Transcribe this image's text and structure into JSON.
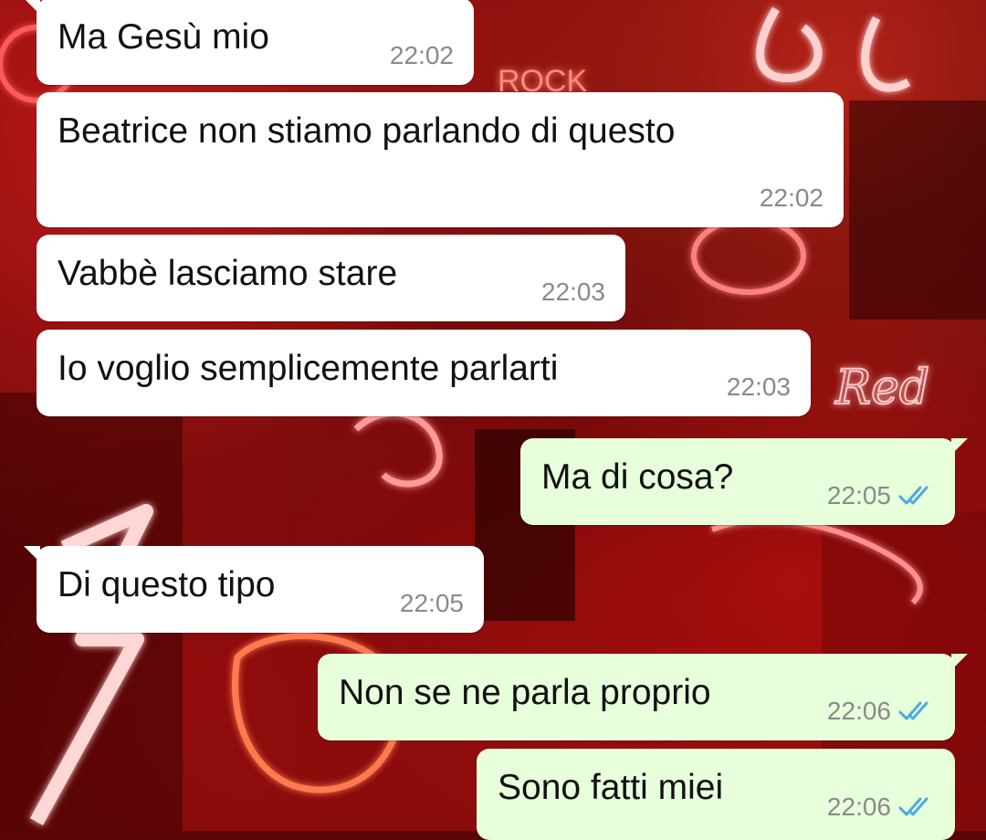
{
  "wallpaper": {
    "sign_rock": "ROCK",
    "sign_red": "Red"
  },
  "messages": [
    {
      "direction": "in",
      "text": "Ma Gesù mio",
      "time": "22:02"
    },
    {
      "direction": "in",
      "text": "Beatrice non stiamo parlando di questo",
      "time": "22:02"
    },
    {
      "direction": "in",
      "text": "Vabbè lasciamo stare",
      "time": "22:03"
    },
    {
      "direction": "in",
      "text": "Io voglio semplicemente parlarti",
      "time": "22:03"
    },
    {
      "direction": "out",
      "text": "Ma di cosa?",
      "time": "22:05",
      "status": "read"
    },
    {
      "direction": "in",
      "text": "Di questo tipo",
      "time": "22:05"
    },
    {
      "direction": "out",
      "text": "Non se ne parla proprio",
      "time": "22:06",
      "status": "read"
    },
    {
      "direction": "out",
      "text": "Sono fatti miei",
      "time": "22:06",
      "status": "read"
    }
  ],
  "colors": {
    "incoming_bubble": "#ffffff",
    "outgoing_bubble": "#e7ffdb",
    "read_ticks": "#4fa8e8",
    "timestamp": "#8a8a8a"
  }
}
